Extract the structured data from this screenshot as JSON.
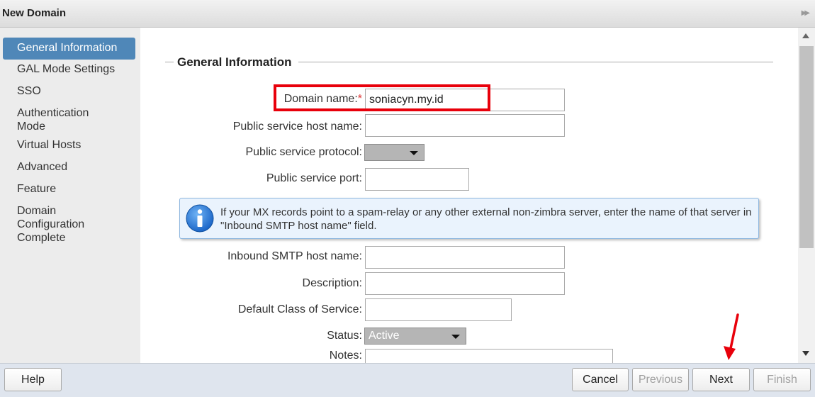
{
  "window": {
    "title": "New Domain"
  },
  "sidebar": {
    "items": [
      {
        "label": "General Information",
        "selected": true
      },
      {
        "label": "GAL Mode Settings"
      },
      {
        "label": "SSO"
      },
      {
        "label": "Authentication\nMode"
      },
      {
        "label": "Virtual Hosts"
      },
      {
        "label": "Advanced"
      },
      {
        "label": "Feature"
      },
      {
        "label": "Domain\nConfiguration\nComplete"
      }
    ]
  },
  "section": {
    "legend": "General Information"
  },
  "form": {
    "domain_name": {
      "label": "Domain name:",
      "required_mark": "*",
      "value": "soniacyn.my.id"
    },
    "public_host": {
      "label": "Public service host name:",
      "value": ""
    },
    "public_protocol": {
      "label": "Public service protocol:",
      "value": ""
    },
    "public_port": {
      "label": "Public service port:",
      "value": ""
    },
    "info_message": "If your MX records point to a spam-relay or any other external non-zimbra server, enter the name of that server in \"Inbound SMTP host name\" field.",
    "inbound_smtp": {
      "label": "Inbound SMTP host name:",
      "value": ""
    },
    "description": {
      "label": "Description:",
      "value": ""
    },
    "default_cos": {
      "label": "Default Class of Service:",
      "value": ""
    },
    "status": {
      "label": "Status:",
      "value": "Active"
    },
    "notes": {
      "label": "Notes:",
      "value": ""
    }
  },
  "footer": {
    "help": "Help",
    "cancel": "Cancel",
    "previous": "Previous",
    "next": "Next",
    "finish": "Finish"
  },
  "colors": {
    "selected_nav": "#4f87b8",
    "highlight": "#e8000b",
    "info_bg": "#eaf3fd",
    "footer_bg": "#dfe5ee"
  },
  "icons": [
    "expand-icon",
    "info-icon",
    "scroll-up-icon",
    "scroll-down-icon",
    "dropdown-arrow-icon"
  ]
}
